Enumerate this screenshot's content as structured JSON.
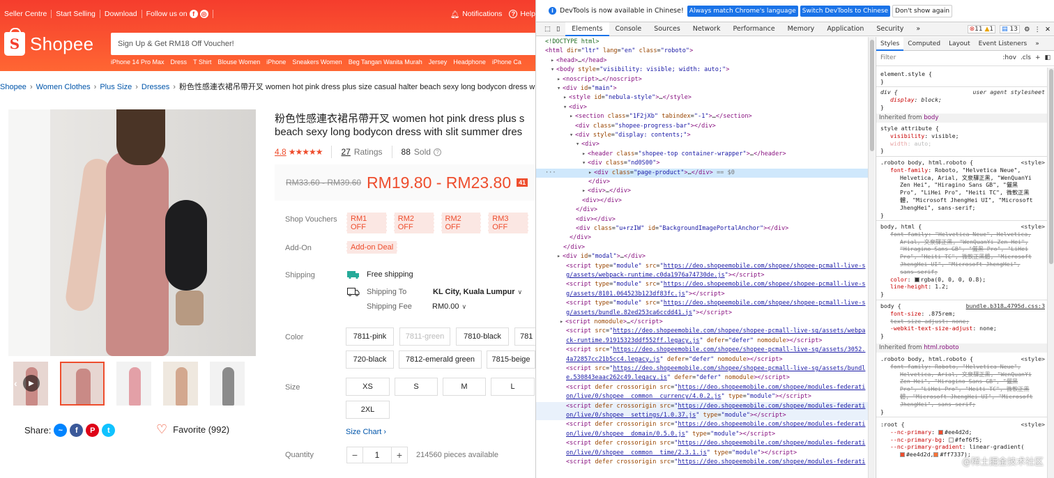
{
  "shopee": {
    "topnav": [
      "Seller Centre",
      "Start Selling",
      "Download",
      "Follow us on"
    ],
    "notifications": "Notifications",
    "help": "Help",
    "logo": "Shopee",
    "search_placeholder": "Sign Up & Get RM18 Off Voucher!",
    "quick_links": [
      "iPhone 14 Pro Max",
      "Dress",
      "T Shirt",
      "Blouse Women",
      "iPhone",
      "Sneakers Women",
      "Beg Tangan Wanita Murah",
      "Jersey",
      "Headphone",
      "iPhone Ca"
    ],
    "breadcrumbs": [
      "Shopee",
      "Women Clothes",
      "Plus Size",
      "Dresses"
    ],
    "breadcrumb_current": "粉色性感連衣裙吊帶开叉 women hot pink dress plus size casual halter beach sexy long bodycon dress with",
    "title_line1": "粉色性感連衣裙吊帶开叉 women hot pink dress plus s",
    "title_line2": "beach sexy long bodycon dress with slit summer dres",
    "rating": "4.8",
    "rating_stars": 5,
    "ratings_count": "27",
    "ratings_label": "Ratings",
    "sold_count": "88",
    "sold_label": "Sold",
    "old_price": "RM33.60 - RM39.60",
    "price": "RM19.80 - RM23.80",
    "discount_badge": "41",
    "labels": {
      "vouchers": "Shop Vouchers",
      "addon": "Add-On",
      "shipping": "Shipping",
      "color": "Color",
      "size": "Size",
      "quantity": "Quantity"
    },
    "vouchers": [
      "RM1 OFF",
      "RM2 OFF",
      "RM2 OFF",
      "RM3 OFF"
    ],
    "addon_deal": "Add-on Deal",
    "free_shipping": "Free shipping",
    "shipping_to_label": "Shipping To",
    "shipping_to_value": "KL City, Kuala Lumpur",
    "shipping_fee_label": "Shipping Fee",
    "shipping_fee_value": "RM0.00",
    "colors": [
      "7811-pink",
      "7811-green",
      "7810-black",
      "781",
      "720-black",
      "7812-emerald green",
      "7815-beige"
    ],
    "sizes": [
      "XS",
      "S",
      "M",
      "L",
      "2XL"
    ],
    "size_chart": "Size Chart",
    "quantity": "1",
    "available": "214560 pieces available",
    "share_label": "Share:",
    "favorite": "Favorite (992)",
    "accent": "#ee4d2d"
  },
  "devtools": {
    "info_text": "DevTools is now available in Chinese!",
    "info_btn1": "Always match Chrome's language",
    "info_btn2": "Switch DevTools to Chinese",
    "info_btn3": "Don't show again",
    "tabs": [
      "Elements",
      "Console",
      "Sources",
      "Network",
      "Performance",
      "Memory",
      "Application",
      "Security"
    ],
    "errors": "11",
    "warnings": "1",
    "messages": "13",
    "styles_tabs": [
      "Styles",
      "Computed",
      "Layout",
      "Event Listeners"
    ],
    "filter_placeholder": "Filter",
    "filter_hov": ":hov",
    "filter_cls": ".cls",
    "inherited_body": "Inherited from",
    "inherited_body_el": "body",
    "inherited_html": "Inherited from",
    "inherited_html_el": "html.roboto",
    "watermark": "@稀土掘金技术社区"
  }
}
